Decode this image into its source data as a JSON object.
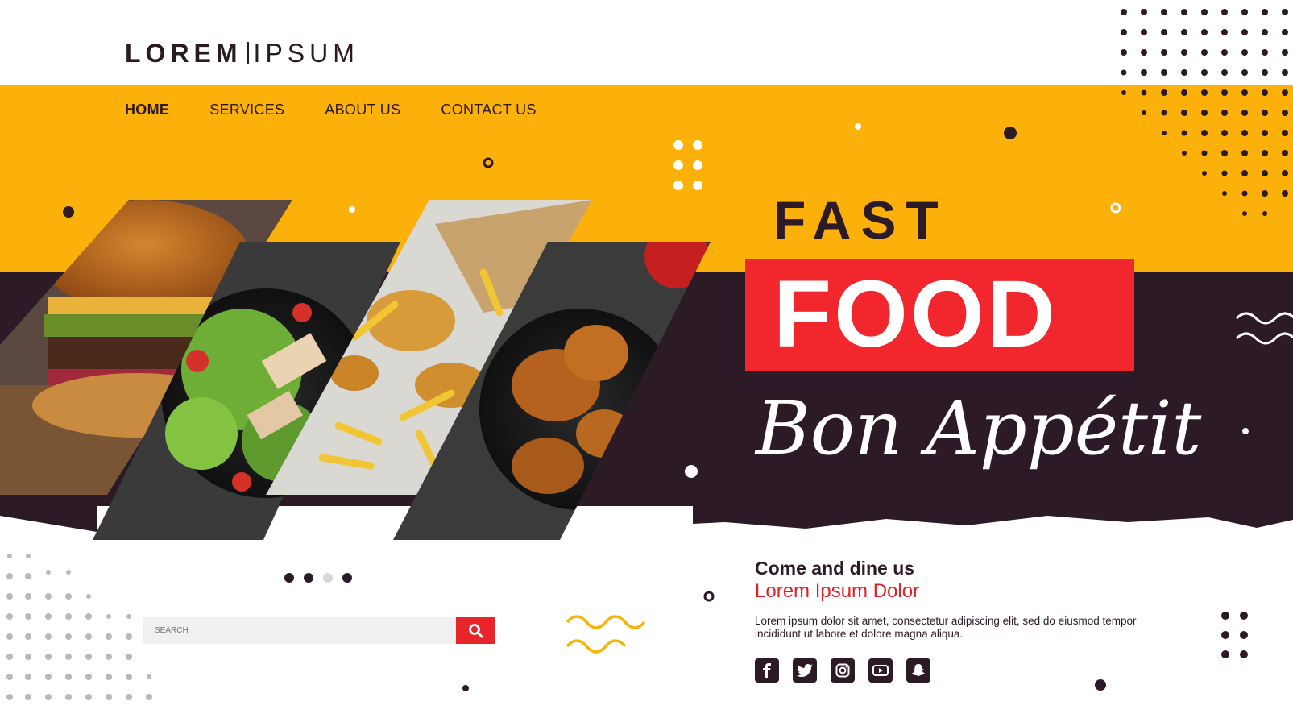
{
  "logo": {
    "bold": "LOREM",
    "light": "IPSUM"
  },
  "nav": {
    "home": "HOME",
    "services": "SERVICES",
    "about": "ABOUT US",
    "contact": "CONTACT US"
  },
  "hero": {
    "fast": "FAST",
    "food": "FOOD",
    "tagline": "Bon Appétit"
  },
  "info": {
    "heading": "Come and dine us",
    "subheading": "Lorem Ipsum Dolor",
    "body": "Lorem ipsum dolor sit amet, consectetur adipiscing elit, sed do eiusmod tempor incididunt ut labore et dolore magna aliqua."
  },
  "search": {
    "placeholder": "SEARCH"
  },
  "slider": {
    "count": 4,
    "active_index": 2
  },
  "social": {
    "icons": [
      "facebook-icon",
      "twitter-icon",
      "instagram-icon",
      "youtube-icon",
      "snapchat-icon"
    ]
  },
  "colors": {
    "yellow": "#fcb10a",
    "dark": "#2d1a27",
    "red": "#f2262d"
  }
}
